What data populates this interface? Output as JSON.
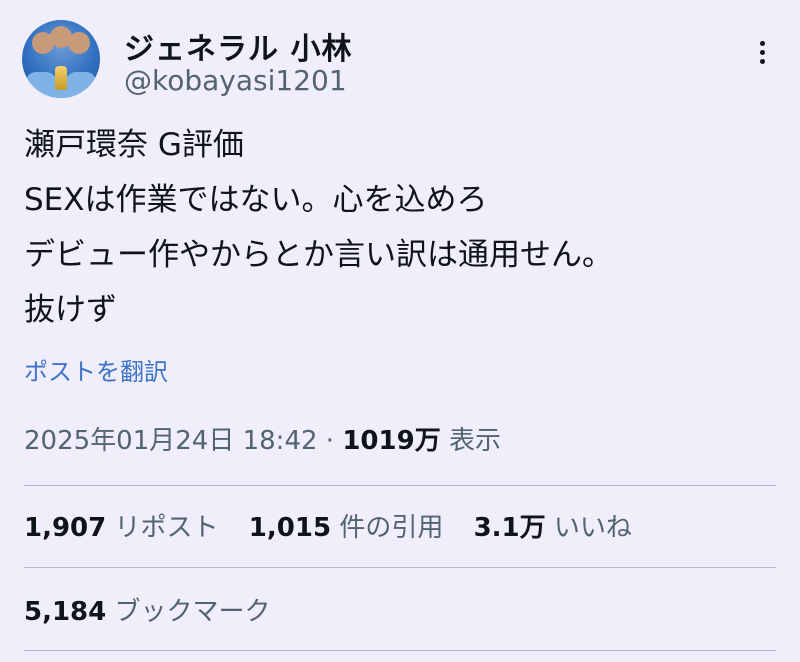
{
  "author": {
    "display_name": "ジェネラル 小林",
    "handle": "@kobayasi1201"
  },
  "tweet": {
    "lines": [
      "瀬戸環奈 G評価",
      "SEXは作業ではない。心を込めろ",
      "デビュー作やからとか言い訳は通用せん。",
      "抜けず"
    ],
    "translate_label": "ポストを翻訳"
  },
  "meta": {
    "timestamp": "2025年01月24日 18:42",
    "separator": "·",
    "views": "1019万",
    "views_label": "表示"
  },
  "stats": {
    "reposts": "1,907",
    "reposts_label": "リポスト",
    "quotes": "1,015",
    "quotes_label": "件の引用",
    "likes": "3.1万",
    "likes_label": "いいね",
    "bookmarks": "5,184",
    "bookmarks_label": "ブックマーク"
  },
  "icons": {
    "more": "more-vertical-icon"
  },
  "colors": {
    "background": "#efeefa",
    "text": "#0f1419",
    "secondary": "#536471",
    "link": "#3d73c8",
    "divider": "#b9b8cf"
  }
}
